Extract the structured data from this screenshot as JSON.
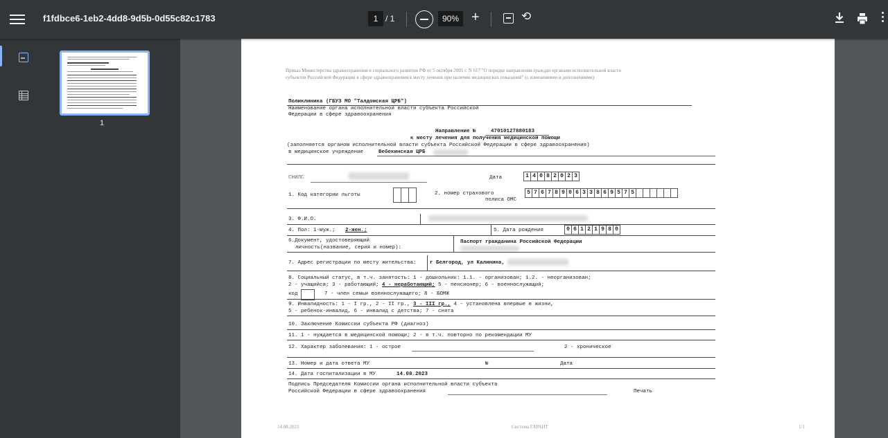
{
  "toolbar": {
    "filename": "f1fdbce6-1eb2-4dd8-9d5b-0d55c82c1783",
    "current_page": "1",
    "page_sep": "/ 1",
    "zoom": "90%",
    "zoom_in": "+",
    "rotate_glyph": "⟲"
  },
  "sidebar": {
    "thumbnail_label": "1"
  },
  "doc": {
    "header_line1": "Приказ Министерства здравоохранения и социального развития РФ от 5 октября 2005 г. N 617 \"О порядке направления граждан органами исполнительной власти",
    "header_line2": "субъектов Российской Федерации в сфере здравоохранения к месту лечения при наличии медицинских показаний\" (с изменениями и дополнениями)",
    "org_name": "Поликлиника (ГБУЗ МО \"Талдомская ЦРБ\")",
    "org_caption1": "Наименование органа исполнительной власти субъекта Российской",
    "org_caption2": "Федерации в сфере здравоохранения",
    "direction_title": "Направление №",
    "direction_number": "47010127880183",
    "direction_subtitle": "к месту лечения для получения медицинской помощи",
    "fill_note": "(заполняется органом исполнительной власти субъекта Российской Федерации в сфере здравоохранения)",
    "med_institution_label": "в медицинское учреждение",
    "med_institution_value": "Вебекинская ЦРБ",
    "snils_label": "СНИЛС",
    "date_label": "Дата",
    "date_digits": [
      "1",
      "4",
      "0",
      "8",
      "2",
      "0",
      "2",
      "3"
    ],
    "f1_label": "1. Код категории льготы",
    "f2_label_a": "2.  номер страхового",
    "f2_label_b": "полиса ОМС",
    "policy_digits": [
      "5",
      "7",
      "6",
      "7",
      "8",
      "9",
      "0",
      "6",
      "3",
      "3",
      "8",
      "6",
      "9",
      "5",
      "7",
      "5",
      "",
      "",
      "",
      "",
      "",
      ""
    ],
    "f3_label": "3. Ф.И.О.",
    "f4_label": "4. Пол:  1-муж.; ",
    "f4_value": "2-жен.;",
    "f5_label": "5. Дата рождения",
    "birth_digits": [
      "0",
      "6",
      "1",
      "2",
      "1",
      "9",
      "8",
      "0"
    ],
    "f6_label_a": "6.Документ, удостоверяющий",
    "f6_label_b": "личность(название, серия и номер):",
    "f6_value": "Паспорт гражданина Российской Федерации",
    "f7_label": "7. Адрес регистрации по месту жительства:",
    "f7_value": "г Белгород, ул Калинина,",
    "f8_line1": "8. Социальный статус, в т.ч. занятость:  1 - дошкольник:  1.1. - организован; 1.2. - неорганизован;",
    "f8_line2a": "2 - учащийся; 3 - работающий; ",
    "f8_line2b": "4 - неработающий;",
    "f8_line2c": " 5 - пенсионер;  6 - военнослужащий;",
    "f8_line3a": "код",
    "f8_line3b": "7 - член семьи военнослужащего;  8 - БОМЖ",
    "f9_line1a": "9. Инвалидность:  1 - I гр.,  2 - II гр., ",
    "f9_line1b": "3 - III гр.,",
    "f9_line1c": "  4 - установлена впервые в жизни,",
    "f9_line2": "5 - ребенок-инвалид, 6 - инвалид с детства; 7 - снята",
    "f10": "10. Заключение Комиссии субъекта РФ (диагноз)",
    "f11": "11. 1 - нуждается в медицинской помощи;  2 - в т.ч. повторно по рекомендации МУ",
    "f12a": "12. Характер заболевания:  1 - острое",
    "f12b": "2 - хроническое",
    "f13a": "13. Номер и дата ответа МУ",
    "f13b": "№",
    "f13c": "Дата",
    "f14_label": "14. Дата госпитализации в МУ",
    "f14_value": "14.08.2023",
    "sign1": "Подпись Председателя Комиссии органа исполнительной власти субъекта",
    "sign2": "Российской Федерации в сфере здравоохранения",
    "stamp": "Печать",
    "footer_date": "14.08.2023",
    "footer_system": "Система ГАРАНТ",
    "footer_pages": "1/1"
  }
}
